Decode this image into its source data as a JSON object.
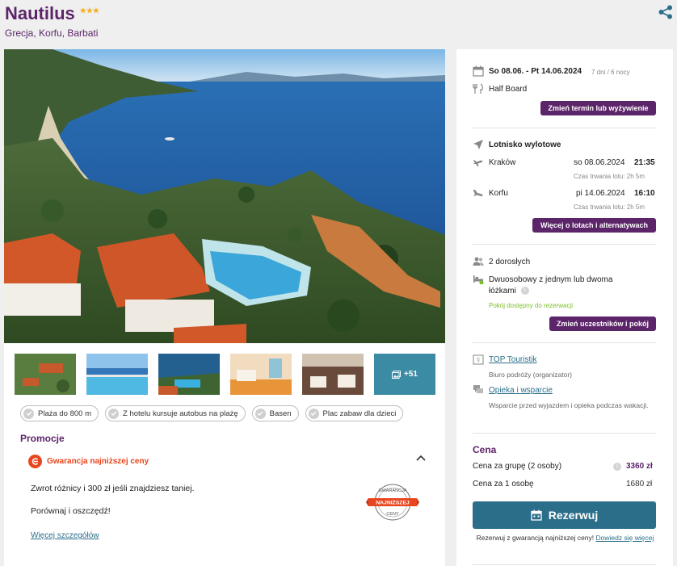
{
  "hotel": {
    "name": "Nautilus",
    "stars": "★★★",
    "location": "Grecja, Korfu, Barbati"
  },
  "gallery": {
    "more_count": "+51",
    "thumbs": [
      "hotel-aerial",
      "pool-sea-view",
      "pool-terrace",
      "room-interior",
      "restaurant"
    ]
  },
  "amenities": [
    "Plaża do 800 m",
    "Z hotelu kursuje autobus na plażę",
    "Basen",
    "Plac zabaw dla dzieci"
  ],
  "promo": {
    "heading": "Promocje",
    "guarantee_title": "Gwarancja najniższej ceny",
    "line1": "Zwrot różnicy i 300 zł jeśli znajdziesz taniej.",
    "line2": "Porównaj i oszczędź!",
    "more_link": "Więcej szczegółów",
    "stamp_top": "GWARANCJA",
    "stamp_mid": "NAJNIŻSZEJ",
    "stamp_bottom": "CENY"
  },
  "booking": {
    "dates": "So 08.06. - Pt 14.06.2024",
    "duration": "7 dni / 6 nocy",
    "board": "Half Board",
    "change_date_btn": "Zmień termin lub wyżywienie",
    "airport_heading": "Lotnisko wylotowe",
    "outbound": {
      "city": "Kraków",
      "date": "so 08.06.2024",
      "time": "21:35",
      "duration": "Czas trwania lotu: 2h 5m"
    },
    "inbound": {
      "city": "Korfu",
      "date": "pi 14.06.2024",
      "time": "16:10",
      "duration": "Czas trwania lotu: 2h 5m"
    },
    "flights_btn": "Więcej o lotach i alternatywach",
    "travellers": "2 dorosłych",
    "room": "Dwuosobowy z jednym lub dwoma łóżkami",
    "room_available": "Pokój dostępny do rezerwacji",
    "change_travellers_btn": "Zmień uczestników i pokój",
    "organizer_name": "TOP Touristik",
    "organizer_desc": "Biuro podróży (organizator)",
    "support_name": "Opieka i wsparcie",
    "support_desc": "Wsparcie przed wyjazdem i opieka podczas wakacji.",
    "price_heading": "Cena",
    "price_group_label": "Cena za grupę (2 osoby)",
    "price_group": "3360 zł",
    "price_person_label": "Cena za 1 osobę",
    "price_person": "1680 zł",
    "reserve_btn": "Rezerwuj",
    "reserve_note": "Rezerwuj z gwarancją najniższej ceny!",
    "reserve_note_link": "Dowiedz się więcej"
  },
  "colors": {
    "brand_purple": "#5c2569",
    "accent_blue": "#2b6e8a",
    "guarantee_red": "#e8461f",
    "available_green": "#7bbf2a",
    "stars_gold": "#f2b01e"
  }
}
